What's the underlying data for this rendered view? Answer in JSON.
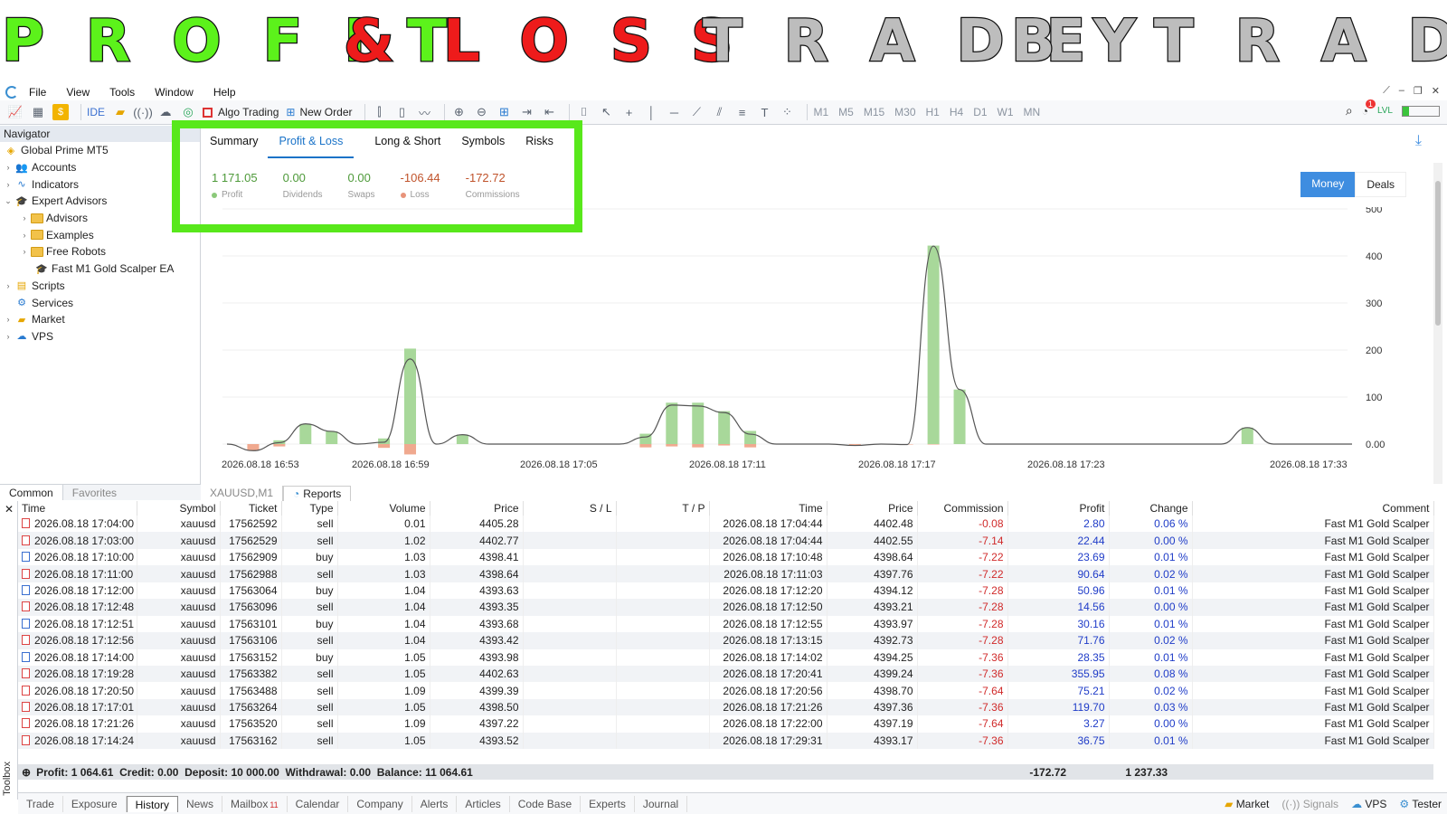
{
  "banner": {
    "words": [
      {
        "text": "PROFIT",
        "color": "#5cf21b"
      },
      {
        "text": "&",
        "color": "#ee1b1b"
      },
      {
        "text": "LOSS",
        "color": "#ee1b1b"
      },
      {
        "text": "TRADE",
        "color": "#bdbdbd"
      },
      {
        "text": "BY",
        "color": "#bdbdbd"
      },
      {
        "text": "TRADE",
        "color": "#bdbdbd"
      }
    ]
  },
  "menu": {
    "items": [
      "File",
      "View",
      "Tools",
      "Window",
      "Help"
    ]
  },
  "toolbar": {
    "algo_trading": "Algo Trading",
    "new_order": "New Order",
    "ide": "IDE",
    "timeframes": [
      "M1",
      "M5",
      "M15",
      "M30",
      "H1",
      "H4",
      "D1",
      "W1",
      "MN"
    ],
    "notification_count": "1"
  },
  "navigator": {
    "title": "Navigator",
    "root": "Global Prime MT5",
    "items": [
      {
        "label": "Accounts",
        "level": 1,
        "icon": "accounts-icon",
        "arrow": "›"
      },
      {
        "label": "Indicators",
        "level": 1,
        "icon": "indicators-icon",
        "arrow": "›"
      },
      {
        "label": "Expert Advisors",
        "level": 1,
        "icon": "expert-advisors-icon",
        "arrow": "⌄"
      },
      {
        "label": "Advisors",
        "level": 2,
        "icon": "folder-icon",
        "arrow": "›"
      },
      {
        "label": "Examples",
        "level": 2,
        "icon": "folder-icon",
        "arrow": "›"
      },
      {
        "label": "Free Robots",
        "level": 2,
        "icon": "folder-icon",
        "arrow": "›"
      },
      {
        "label": "Fast M1 Gold Scalper EA",
        "level": 2,
        "icon": "expert-icon",
        "arrow": ""
      },
      {
        "label": "Scripts",
        "level": 1,
        "icon": "scripts-icon",
        "arrow": "›"
      },
      {
        "label": "Services",
        "level": 1,
        "icon": "services-icon",
        "arrow": ""
      },
      {
        "label": "Market",
        "level": 1,
        "icon": "market-icon",
        "arrow": "›"
      },
      {
        "label": "VPS",
        "level": 1,
        "icon": "vps-icon",
        "arrow": "›"
      }
    ],
    "tabs": [
      "Common",
      "Favorites"
    ]
  },
  "report": {
    "tabs": [
      "Summary",
      "Profit & Loss",
      "Long & Short",
      "Symbols",
      "Risks"
    ],
    "active_tab": "Profit & Loss",
    "stats": [
      {
        "value": "1 171.05",
        "label": "Profit",
        "color": "#4e9a3a",
        "dot": "#8bc97a"
      },
      {
        "value": "0.00",
        "label": "Dividends",
        "color": "#4e9a3a",
        "dot": ""
      },
      {
        "value": "0.00",
        "label": "Swaps",
        "color": "#4e9a3a",
        "dot": ""
      },
      {
        "value": "-106.44",
        "label": "Loss",
        "color": "#c0532b",
        "dot": "#e8937a"
      },
      {
        "value": "-172.72",
        "label": "Commissions",
        "color": "#c0532b",
        "dot": ""
      }
    ],
    "toggle": {
      "money": "Money",
      "deals": "Deals"
    }
  },
  "chart_data": {
    "type": "bar",
    "x_labels": [
      "2026.08.18 16:53",
      "2026.08.18 16:59",
      "2026.08.18 17:05",
      "2026.08.18 17:11",
      "2026.08.18 17:17",
      "2026.08.18 17:23",
      "2026.08.18 17:33"
    ],
    "y_ticks": [
      "0.00",
      "100",
      "200",
      "300",
      "400",
      "500"
    ],
    "ylim": [
      0,
      500
    ],
    "profit_bars": [
      0,
      0,
      8,
      43,
      27,
      0,
      12,
      203,
      0,
      20,
      0,
      0,
      0,
      0,
      0,
      0,
      22,
      88,
      88,
      70,
      28,
      0,
      0,
      0,
      0,
      0,
      0,
      422,
      116,
      0,
      0,
      0,
      0,
      0,
      0,
      0,
      0,
      0,
      0,
      35,
      0,
      0,
      0,
      0
    ],
    "loss_bars": [
      0,
      -14,
      -5,
      0,
      0,
      0,
      -8,
      -22,
      0,
      0,
      0,
      0,
      0,
      0,
      0,
      0,
      -7,
      -5,
      -7,
      -3,
      -7,
      0,
      0,
      0,
      -3,
      0,
      -1,
      -1,
      0,
      0,
      0,
      0,
      0,
      0,
      0,
      0,
      0,
      0,
      0,
      0,
      0,
      0,
      0,
      0
    ],
    "bar_colors": {
      "profit": "#a8d89a",
      "loss": "#f0a98f",
      "line": "#555555"
    }
  },
  "symbol_tab": "XAUUSD,M1",
  "reports_tab": "Reports",
  "history": {
    "columns": [
      "Time",
      "Symbol",
      "Ticket",
      "Type",
      "Volume",
      "Price",
      "S / L",
      "T / P",
      "Time",
      "Price",
      "Commission",
      "Profit",
      "Change",
      "Comment"
    ],
    "rows": [
      [
        "2026.08.18 17:04:00",
        "xauusd",
        "17562592",
        "sell",
        "0.01",
        "4405.28",
        "",
        "",
        "2026.08.18 17:04:44",
        "4402.48",
        "-0.08",
        "2.80",
        "0.06 %",
        "Fast M1 Gold Scalper"
      ],
      [
        "2026.08.18 17:03:00",
        "xauusd",
        "17562529",
        "sell",
        "1.02",
        "4402.77",
        "",
        "",
        "2026.08.18 17:04:44",
        "4402.55",
        "-7.14",
        "22.44",
        "0.00 %",
        "Fast M1 Gold Scalper"
      ],
      [
        "2026.08.18 17:10:00",
        "xauusd",
        "17562909",
        "buy",
        "1.03",
        "4398.41",
        "",
        "",
        "2026.08.18 17:10:48",
        "4398.64",
        "-7.22",
        "23.69",
        "0.01 %",
        "Fast M1 Gold Scalper"
      ],
      [
        "2026.08.18 17:11:00",
        "xauusd",
        "17562988",
        "sell",
        "1.03",
        "4398.64",
        "",
        "",
        "2026.08.18 17:11:03",
        "4397.76",
        "-7.22",
        "90.64",
        "0.02 %",
        "Fast M1 Gold Scalper"
      ],
      [
        "2026.08.18 17:12:00",
        "xauusd",
        "17563064",
        "buy",
        "1.04",
        "4393.63",
        "",
        "",
        "2026.08.18 17:12:20",
        "4394.12",
        "-7.28",
        "50.96",
        "0.01 %",
        "Fast M1 Gold Scalper"
      ],
      [
        "2026.08.18 17:12:48",
        "xauusd",
        "17563096",
        "sell",
        "1.04",
        "4393.35",
        "",
        "",
        "2026.08.18 17:12:50",
        "4393.21",
        "-7.28",
        "14.56",
        "0.00 %",
        "Fast M1 Gold Scalper"
      ],
      [
        "2026.08.18 17:12:51",
        "xauusd",
        "17563101",
        "buy",
        "1.04",
        "4393.68",
        "",
        "",
        "2026.08.18 17:12:55",
        "4393.97",
        "-7.28",
        "30.16",
        "0.01 %",
        "Fast M1 Gold Scalper"
      ],
      [
        "2026.08.18 17:12:56",
        "xauusd",
        "17563106",
        "sell",
        "1.04",
        "4393.42",
        "",
        "",
        "2026.08.18 17:13:15",
        "4392.73",
        "-7.28",
        "71.76",
        "0.02 %",
        "Fast M1 Gold Scalper"
      ],
      [
        "2026.08.18 17:14:00",
        "xauusd",
        "17563152",
        "buy",
        "1.05",
        "4393.98",
        "",
        "",
        "2026.08.18 17:14:02",
        "4394.25",
        "-7.36",
        "28.35",
        "0.01 %",
        "Fast M1 Gold Scalper"
      ],
      [
        "2026.08.18 17:19:28",
        "xauusd",
        "17563382",
        "sell",
        "1.05",
        "4402.63",
        "",
        "",
        "2026.08.18 17:20:41",
        "4399.24",
        "-7.36",
        "355.95",
        "0.08 %",
        "Fast M1 Gold Scalper"
      ],
      [
        "2026.08.18 17:20:50",
        "xauusd",
        "17563488",
        "sell",
        "1.09",
        "4399.39",
        "",
        "",
        "2026.08.18 17:20:56",
        "4398.70",
        "-7.64",
        "75.21",
        "0.02 %",
        "Fast M1 Gold Scalper"
      ],
      [
        "2026.08.18 17:17:01",
        "xauusd",
        "17563264",
        "sell",
        "1.05",
        "4398.50",
        "",
        "",
        "2026.08.18 17:21:26",
        "4397.36",
        "-7.36",
        "119.70",
        "0.03 %",
        "Fast M1 Gold Scalper"
      ],
      [
        "2026.08.18 17:21:26",
        "xauusd",
        "17563520",
        "sell",
        "1.09",
        "4397.22",
        "",
        "",
        "2026.08.18 17:22:00",
        "4397.19",
        "-7.64",
        "3.27",
        "0.00 %",
        "Fast M1 Gold Scalper"
      ],
      [
        "2026.08.18 17:14:24",
        "xauusd",
        "17563162",
        "sell",
        "1.05",
        "4393.52",
        "",
        "",
        "2026.08.18 17:29:31",
        "4393.17",
        "-7.36",
        "36.75",
        "0.01 %",
        "Fast M1 Gold Scalper"
      ]
    ],
    "summary": {
      "text": "Profit: 1 064.61  Credit: 0.00  Deposit: 10 000.00  Withdrawal: 0.00  Balance: 11 064.61",
      "commission": "-172.72",
      "profit": "1 237.33"
    }
  },
  "bottom_tabs": [
    {
      "label": "Trade"
    },
    {
      "label": "Exposure"
    },
    {
      "label": "History",
      "active": true
    },
    {
      "label": "News"
    },
    {
      "label": "Mailbox",
      "badge": "11"
    },
    {
      "label": "Calendar"
    },
    {
      "label": "Company"
    },
    {
      "label": "Alerts"
    },
    {
      "label": "Articles"
    },
    {
      "label": "Code Base"
    },
    {
      "label": "Experts"
    },
    {
      "label": "Journal"
    }
  ],
  "status_right": [
    "Market",
    "Signals",
    "VPS",
    "Tester"
  ],
  "toolbox_label": "Toolbox"
}
